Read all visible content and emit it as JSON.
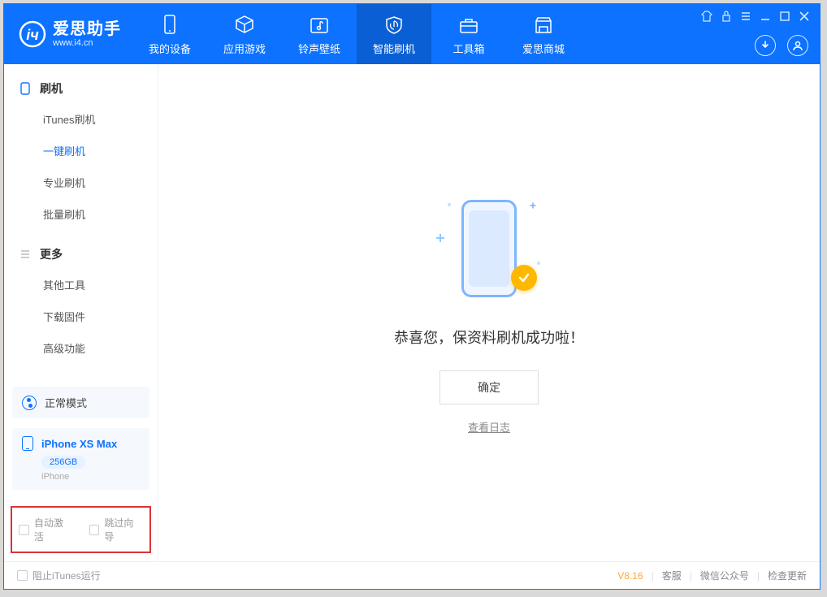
{
  "app": {
    "title": "爱思助手",
    "subtitle": "www.i4.cn"
  },
  "nav": {
    "items": [
      {
        "label": "我的设备"
      },
      {
        "label": "应用游戏"
      },
      {
        "label": "铃声壁纸"
      },
      {
        "label": "智能刷机"
      },
      {
        "label": "工具箱"
      },
      {
        "label": "爱思商城"
      }
    ]
  },
  "sidebar": {
    "group1": {
      "title": "刷机",
      "items": [
        "iTunes刷机",
        "一键刷机",
        "专业刷机",
        "批量刷机"
      ]
    },
    "group2": {
      "title": "更多",
      "items": [
        "其他工具",
        "下载固件",
        "高级功能"
      ]
    },
    "mode": "正常模式",
    "device": {
      "name": "iPhone XS Max",
      "storage": "256GB",
      "type": "iPhone"
    },
    "checks": {
      "auto_activate": "自动激活",
      "skip_guide": "跳过向导"
    }
  },
  "main": {
    "success_text": "恭喜您，保资料刷机成功啦！",
    "ok_button": "确定",
    "view_log": "查看日志"
  },
  "footer": {
    "block_itunes": "阻止iTunes运行",
    "version": "V8.16",
    "links": [
      "客服",
      "微信公众号",
      "检查更新"
    ]
  }
}
